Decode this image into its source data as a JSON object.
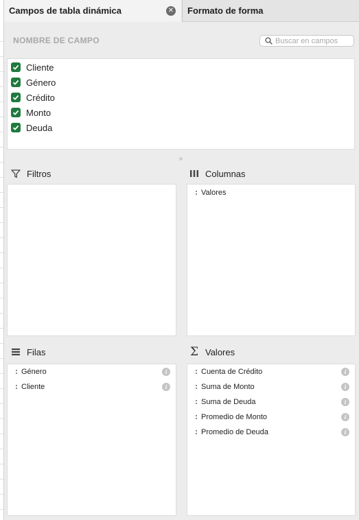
{
  "tabs": {
    "pivot_fields": "Campos de tabla dinámica",
    "shape_format": "Formato de forma"
  },
  "field_list": {
    "header": "NOMBRE DE CAMPO",
    "search_placeholder": "Buscar en campos",
    "fields": [
      {
        "name": "Cliente",
        "checked": true
      },
      {
        "name": "Género",
        "checked": true
      },
      {
        "name": "Crédito",
        "checked": true
      },
      {
        "name": "Monto",
        "checked": true
      },
      {
        "name": "Deuda",
        "checked": true
      }
    ]
  },
  "areas": {
    "filters": {
      "title": "Filtros",
      "items": []
    },
    "columns": {
      "title": "Columnas",
      "items": [
        "Valores"
      ]
    },
    "rows": {
      "title": "Filas",
      "items": [
        "Género",
        "Cliente"
      ]
    },
    "values": {
      "title": "Valores",
      "items": [
        "Cuenta de Crédito",
        "Suma de Monto",
        "Suma de Deuda",
        "Promedio de Monto",
        "Promedio de Deuda"
      ]
    }
  },
  "colors": {
    "checkbox": "#1f7a3e",
    "panel_bg": "#ececec",
    "header_text": "#a8a8a8"
  }
}
